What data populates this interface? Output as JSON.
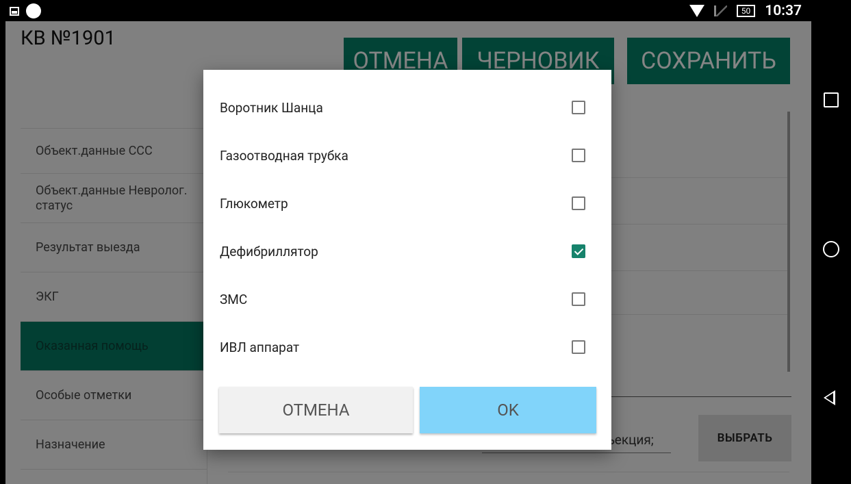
{
  "status_bar": {
    "time": "10:37",
    "battery": "50"
  },
  "app": {
    "title": "КВ №1901",
    "top_buttons": {
      "cancel": "ОТМЕНА",
      "draft": "ЧЕРНОВИК",
      "save": "СОХРАНИТЬ"
    },
    "sidebar": {
      "items": [
        {
          "label": "Объект.данные ССС"
        },
        {
          "label": "Объект.данные Невролог. статус"
        },
        {
          "label": "Результат выезда"
        },
        {
          "label": "ЭКГ"
        },
        {
          "label": "Оказанная помощь"
        },
        {
          "label": "Особые отметки"
        },
        {
          "label": "Назначение"
        }
      ]
    },
    "field_value": "ъекция;",
    "select_button": "ВЫБРАТЬ"
  },
  "dialog": {
    "options": [
      {
        "label": "Воротник Шанца",
        "checked": false
      },
      {
        "label": "Газоотводная трубка",
        "checked": false
      },
      {
        "label": "Глюкометр",
        "checked": false
      },
      {
        "label": "Дефибриллятор",
        "checked": true
      },
      {
        "label": "ЗМС",
        "checked": false
      },
      {
        "label": "ИВЛ аппарат",
        "checked": false
      }
    ],
    "cancel_label": "ОТМЕНА",
    "ok_label": "OK"
  },
  "colors": {
    "accent": "#047a63",
    "ok_button": "#81d4fa",
    "checkbox_checked": "#16836c"
  }
}
